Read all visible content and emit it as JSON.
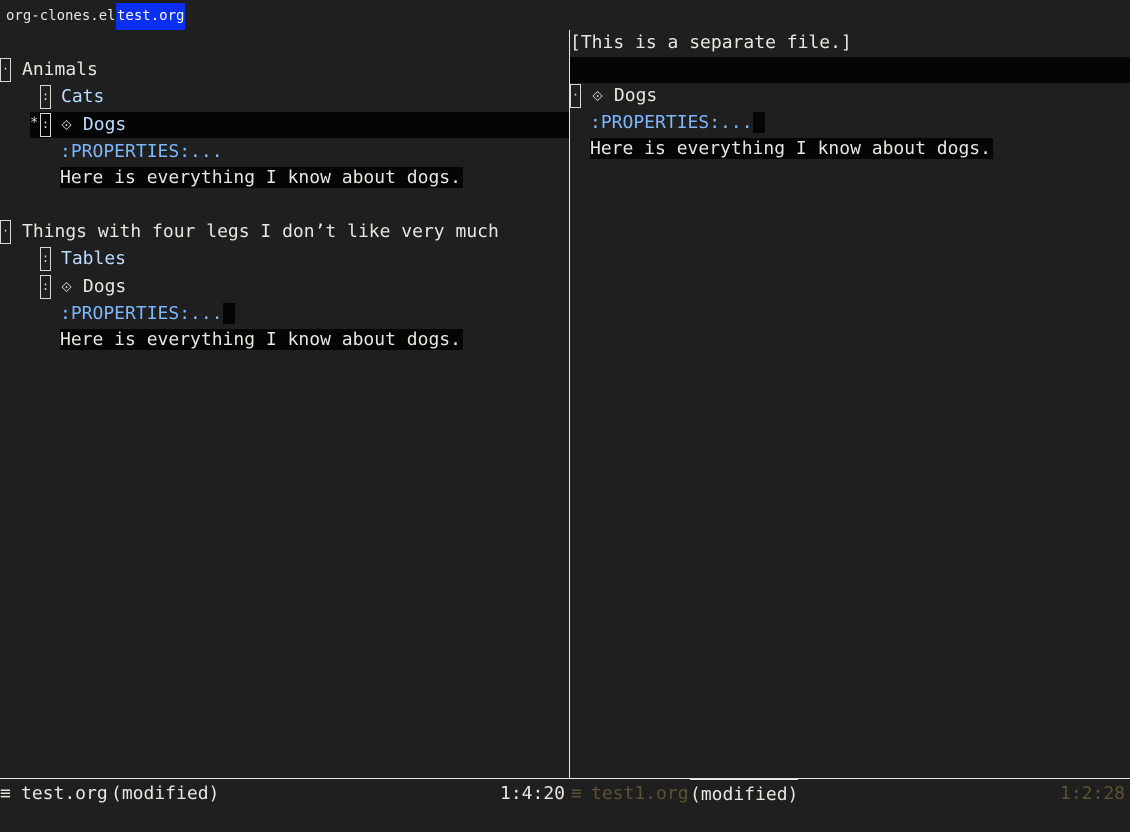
{
  "tabs": [
    {
      "label": "org-clones.el",
      "active": false
    },
    {
      "label": "test.org",
      "active": true
    }
  ],
  "left_pane": {
    "h1a": "Animals",
    "h2a_cats": "Cats",
    "h2a_dogs": "Dogs",
    "props1": ":PROPERTIES:...",
    "body1": "Here is everything I know about dogs.",
    "h1b": "Things with four legs I don’t like very much",
    "h2b_tables": "Tables",
    "h2b_dogs": "Dogs",
    "props2": ":PROPERTIES:...",
    "body2": "Here is everything I know about dogs."
  },
  "right_pane": {
    "header_line": "[This is a separate file.]",
    "h1_dogs": "Dogs",
    "props": ":PROPERTIES:...",
    "body": "Here is everything I know about dogs."
  },
  "glyphs": {
    "fold_dot": "·",
    "fold_colon": ":",
    "diamond": "⟐",
    "menu": "≡",
    "star_marker": "*"
  },
  "modeline": {
    "left_file": "test.org",
    "left_status": "(modified)",
    "left_position": "1:4:20",
    "right_file": "test1.org",
    "right_status": "(modified)",
    "right_position": "1:2:28"
  },
  "colors": {
    "background": "#1f1f1f",
    "active_tab": "#0a2ff0",
    "property": "#7cb7ff",
    "subheading": "#b9dcff",
    "dim_text": "#5b5230"
  }
}
